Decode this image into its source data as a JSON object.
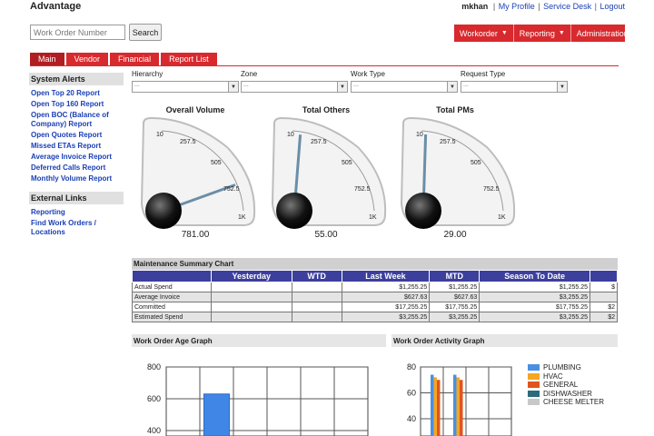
{
  "app": {
    "title": "Advantage"
  },
  "user": {
    "name": "mkhan",
    "links": [
      "My Profile",
      "Service Desk",
      "Logout"
    ],
    "separator": "|"
  },
  "search": {
    "placeholder": "Work Order Number",
    "button": "Search"
  },
  "topmenu": [
    {
      "label": "Workorder",
      "caret": "▼"
    },
    {
      "label": "Reporting",
      "caret": "▼"
    },
    {
      "label": "Administration",
      "caret": "▼"
    }
  ],
  "tabs": [
    "Main",
    "Vendor",
    "Financial",
    "Report List"
  ],
  "sidebar": {
    "alerts_title": "System Alerts",
    "alerts": [
      "Open Top 20 Report",
      "Open Top 160 Report",
      "Open BOC (Balance of Company) Report",
      "Open Quotes Report",
      "Missed ETAs Report",
      "Average Invoice Report",
      "Deferred Calls Report",
      "Monthly Volume Report"
    ],
    "links_title": "External Links",
    "links": [
      "Reporting",
      "Find Work Orders / Locations"
    ]
  },
  "filters": [
    {
      "label": "Hierarchy",
      "value": "..."
    },
    {
      "label": "Zone",
      "value": "..."
    },
    {
      "label": "Work Type",
      "value": "..."
    },
    {
      "label": "Request Type",
      "value": "..."
    }
  ],
  "gauges": [
    {
      "title": "Overall Volume",
      "value": "781.00",
      "ticks": [
        "10",
        "257.5",
        "505",
        "752.5",
        "1K"
      ],
      "fraction": 0.78
    },
    {
      "title": "Total Others",
      "value": "55.00",
      "ticks": [
        "10",
        "257.5",
        "505",
        "752.5",
        "1K"
      ],
      "fraction": 0.05
    },
    {
      "title": "Total PMs",
      "value": "29.00",
      "ticks": [
        "10",
        "257.5",
        "505",
        "752.5",
        "1K"
      ],
      "fraction": 0.02
    }
  ],
  "summary": {
    "title": "Maintenance Summary Chart",
    "columns": [
      "",
      "Yesterday",
      "WTD",
      "Last Week",
      "MTD",
      "Season To Date",
      ""
    ],
    "rows": [
      {
        "label": "Actual Spend",
        "cells": [
          "",
          "",
          "$1,255.25",
          "$1,255.25",
          "$1,255.25",
          "$"
        ]
      },
      {
        "label": "Average Invoice",
        "cells": [
          "",
          "",
          "$627.63",
          "$627.63",
          "$3,255.25",
          ""
        ]
      },
      {
        "label": "Committed",
        "cells": [
          "",
          "",
          "$17,255.25",
          "$17,755.25",
          "$17,755.25",
          "$2"
        ]
      },
      {
        "label": "Estimated Spend",
        "cells": [
          "",
          "",
          "$3,255.25",
          "$3,255.25",
          "$3,255.25",
          "$2"
        ]
      }
    ]
  },
  "age_graph": {
    "title": "Work Order Age Graph",
    "y_ticks": [
      "800",
      "600",
      "400"
    ],
    "bar_color": "#3f86e6"
  },
  "activity_graph": {
    "title": "Work Order Activity Graph",
    "y_ticks": [
      "80",
      "60",
      "40"
    ]
  },
  "legend": [
    {
      "label": "PLUMBING",
      "color": "#4a90e2"
    },
    {
      "label": "HVAC",
      "color": "#f5a623"
    },
    {
      "label": "GENERAL",
      "color": "#e0541d"
    },
    {
      "label": "DISHWASHER",
      "color": "#2c6b7a"
    },
    {
      "label": "CHEESE MELTER",
      "color": "#c8c8c8"
    }
  ],
  "chart_data": [
    {
      "type": "bar",
      "title": "Work Order Age Graph",
      "xlabel": "",
      "ylabel": "",
      "categories": [
        "",
        "",
        "",
        "",
        "",
        ""
      ],
      "values": [
        0,
        630,
        0,
        0,
        0,
        0
      ],
      "ylim": [
        300,
        800
      ]
    },
    {
      "type": "bar",
      "title": "Work Order Activity Graph",
      "xlabel": "",
      "ylabel": "",
      "categories": [
        "",
        ""
      ],
      "series": [
        {
          "name": "PLUMBING",
          "values": [
            74,
            74
          ]
        },
        {
          "name": "HVAC",
          "values": [
            72,
            72
          ]
        },
        {
          "name": "GENERAL",
          "values": [
            70,
            70
          ]
        },
        {
          "name": "DISHWASHER",
          "values": [
            0,
            0
          ]
        },
        {
          "name": "CHEESE MELTER",
          "values": [
            0,
            0
          ]
        }
      ],
      "ylim": [
        30,
        80
      ]
    }
  ],
  "colors": {
    "accent": "#d8292e",
    "tab_active": "#b01e22",
    "table_header": "#3c3f9c",
    "link": "#1a3fb5"
  }
}
